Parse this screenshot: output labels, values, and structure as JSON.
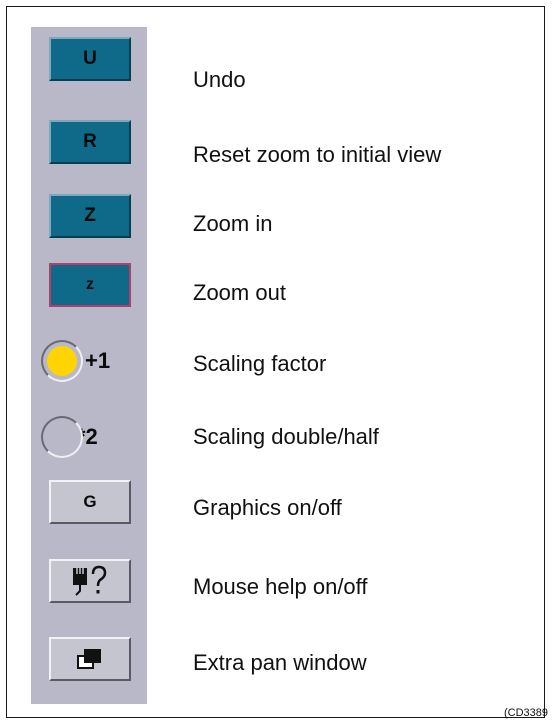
{
  "buttons": [
    {
      "glyph": "U",
      "label": "Undo"
    },
    {
      "glyph": "R",
      "label": "Reset zoom to initial view"
    },
    {
      "glyph": "Z",
      "label": "Zoom in"
    },
    {
      "glyph": "z",
      "label": "Zoom out"
    }
  ],
  "radios": [
    {
      "glyph": "+1",
      "label": "Scaling factor",
      "selected": true
    },
    {
      "glyph": "*2",
      "label": "Scaling double/half",
      "selected": false
    }
  ],
  "graphics": {
    "glyph": "G",
    "label": "Graphics on/off"
  },
  "mouse_help": {
    "icon": "mouse-question-icon",
    "label": "Mouse help on/off"
  },
  "pan_window": {
    "icon": "overlapping-windows-icon",
    "label": "Extra pan window"
  },
  "caption": "(CD3389",
  "colors": {
    "teal": "#0e6a88",
    "toolbar": "#b8b8c8",
    "radio_on": "#ffd400",
    "selected_border": "#b0406a"
  }
}
